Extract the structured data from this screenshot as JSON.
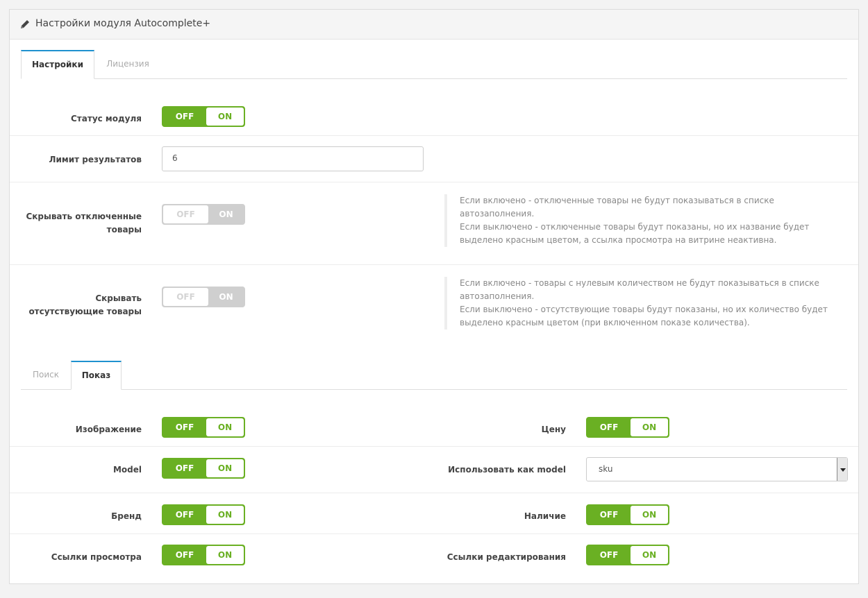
{
  "panel": {
    "title": "Настройки модуля Autocomplete+",
    "icon": "pencil-icon"
  },
  "main_tabs": [
    {
      "label": "Настройки",
      "active": true
    },
    {
      "label": "Лицензия",
      "active": false
    }
  ],
  "toggle": {
    "off": "OFF",
    "on": "ON"
  },
  "settings": {
    "status": {
      "label": "Статус модуля",
      "value": "ON"
    },
    "limit": {
      "label": "Лимит результатов",
      "value": "6"
    },
    "hide_disabled": {
      "label_line1": "Скрывать отключенные",
      "label_line2": "товары",
      "value": "OFF",
      "help": [
        "Если включено - отключенные товары не будут показываться в списке",
        "автозаполнения.",
        "Если выключено - отключенные товары будут показаны, но их название будет",
        "выделено красным цветом, а ссылка просмотра на витрине неактивна."
      ]
    },
    "hide_out_of_stock": {
      "label_line1": "Скрывать",
      "label_line2": "отсутствующие товары",
      "value": "OFF",
      "help": [
        "Если включено - товары с нулевым количеством не будут показываться в списке",
        "автозаполнения.",
        "Если выключено - отсутствующие товары будут показаны, но их количество будет",
        "выделено красным цветом (при включенном показе количества)."
      ]
    }
  },
  "sub_tabs": [
    {
      "label": "Поиск",
      "active": false
    },
    {
      "label": "Показ",
      "active": true
    }
  ],
  "display": {
    "image": {
      "label": "Изображение",
      "value": "ON"
    },
    "price": {
      "label": "Цену",
      "value": "ON"
    },
    "model": {
      "label": "Model",
      "value": "ON"
    },
    "use_as_model": {
      "label": "Использовать как model",
      "value": "sku"
    },
    "brand": {
      "label": "Бренд",
      "value": "ON"
    },
    "stock": {
      "label": "Наличие",
      "value": "ON"
    },
    "view_links": {
      "label": "Ссылки просмотра",
      "value": "ON"
    },
    "edit_links": {
      "label": "Ссылки редактирования",
      "value": "ON"
    }
  },
  "colors": {
    "toggle_green": "#6ab023",
    "toggle_disabled": "#cfcfcf",
    "tab_accent": "#1e91cf"
  }
}
